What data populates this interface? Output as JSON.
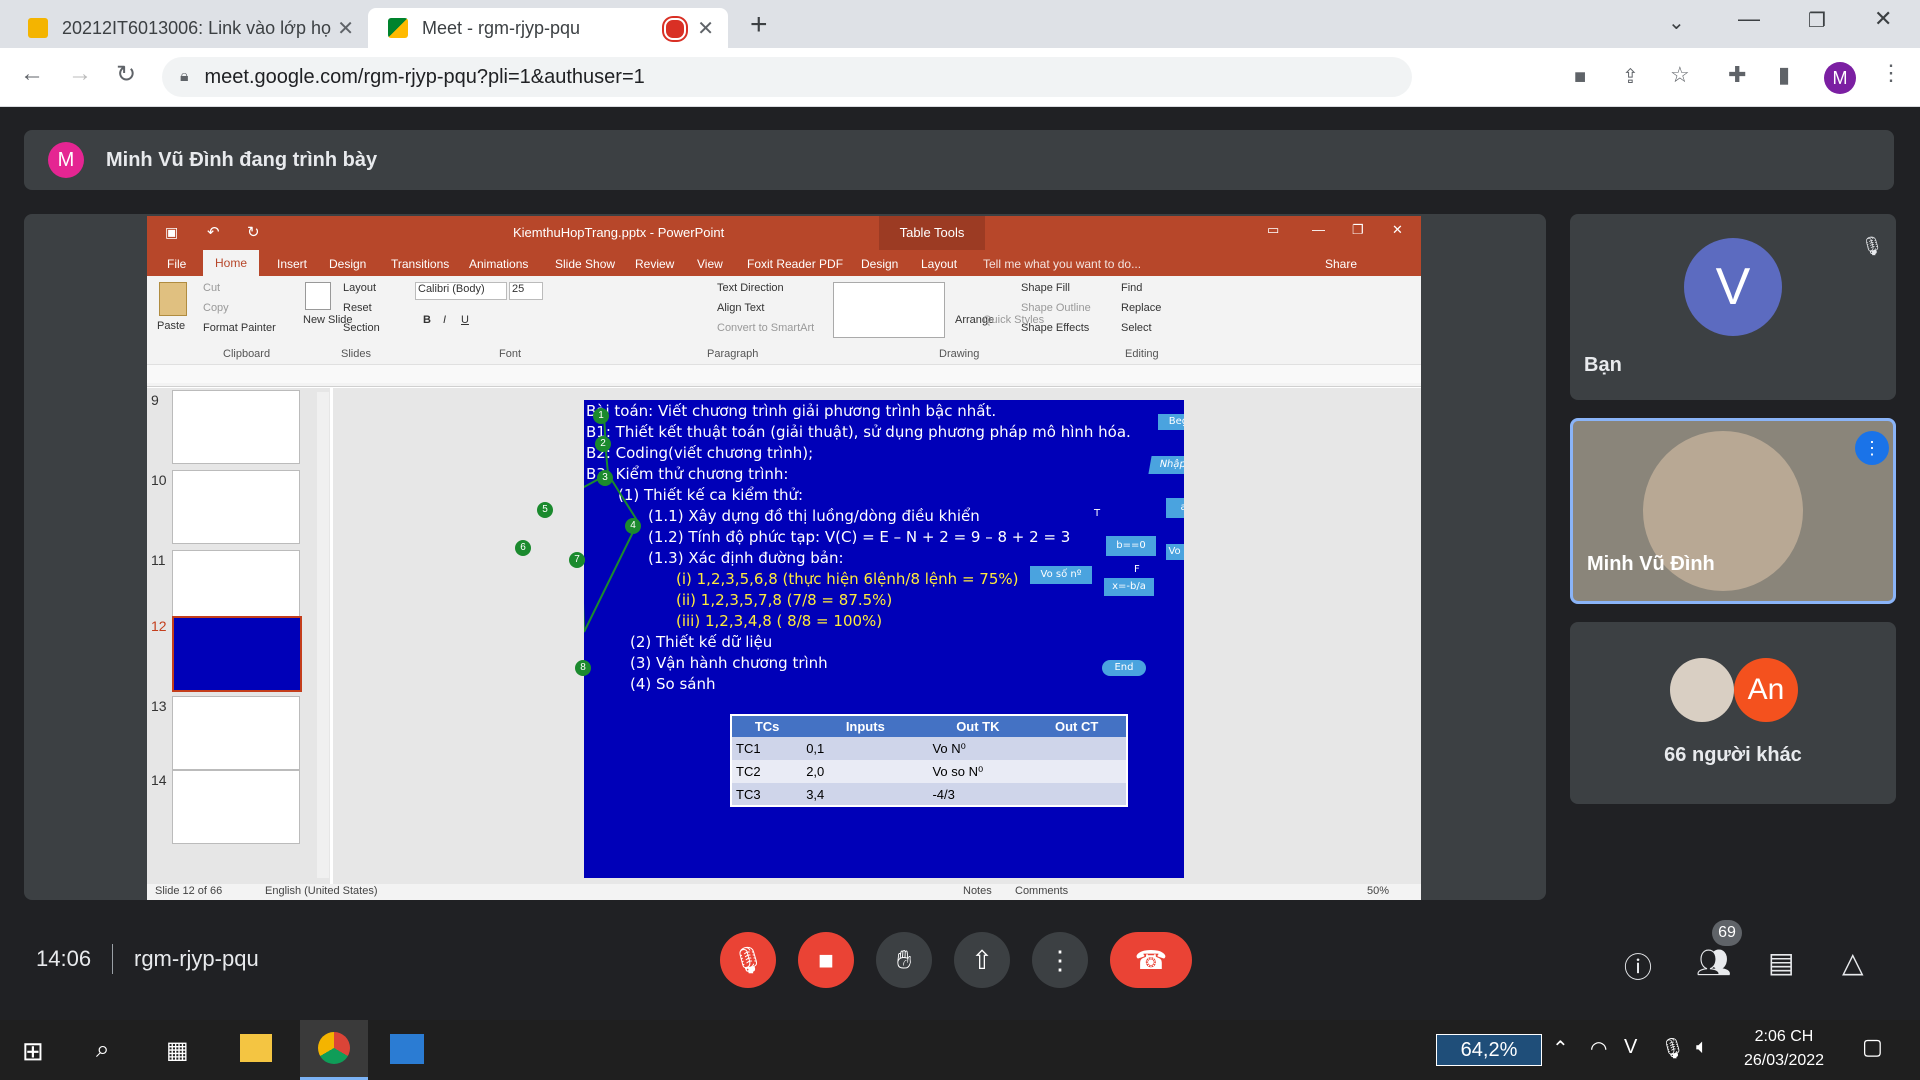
{
  "browser": {
    "tabs": [
      {
        "title": "20212IT6013006: Link vào lớp họ"
      },
      {
        "title": "Meet - rgm-rjyp-pqu"
      }
    ],
    "url": "meet.google.com/rgm-rjyp-pqu?pli=1&authuser=1",
    "profile_initial": "M"
  },
  "meet": {
    "presenter_initial": "M",
    "presenter_banner": "Minh Vũ Đình đang trình bày",
    "time": "14:06",
    "meeting_code": "rgm-rjyp-pqu",
    "participant_count": "69",
    "tiles": [
      {
        "initial": "V",
        "name": "Bạn"
      },
      {
        "name": "Minh Vũ Đình"
      },
      {
        "initial": "An",
        "name": "66 người khác"
      }
    ]
  },
  "ppt": {
    "window_title": "KiemthuHopTrang.pptx - PowerPoint",
    "contextual": "Table Tools",
    "menu": [
      "File",
      "Home",
      "Insert",
      "Design",
      "Transitions",
      "Animations",
      "Slide Show",
      "Review",
      "View",
      "Foxit Reader PDF",
      "Design",
      "Layout"
    ],
    "tell_me": "Tell me what you want to do...",
    "share": "Share",
    "ribbon": {
      "paste": "Paste",
      "cut": "Cut",
      "copy": "Copy",
      "format_painter": "Format Painter",
      "clipboard": "Clipboard",
      "new_slide": "New Slide",
      "layout": "Layout",
      "reset": "Reset",
      "section": "Section",
      "slides": "Slides",
      "font_name": "Calibri (Body)",
      "font_size": "25",
      "font": "Font",
      "text_direction": "Text Direction",
      "align_text": "Align Text",
      "convert_smartart": "Convert to SmartArt",
      "paragraph": "Paragraph",
      "arrange": "Arrange",
      "quick_styles": "Quick Styles",
      "shape_fill": "Shape Fill",
      "shape_outline": "Shape Outline",
      "shape_effects": "Shape Effects",
      "drawing": "Drawing",
      "find": "Find",
      "replace": "Replace",
      "select": "Select",
      "editing": "Editing"
    },
    "thumb_numbers": [
      "9",
      "10",
      "11",
      "12",
      "13",
      "14"
    ],
    "status": {
      "slide": "Slide 12 of 66",
      "lang": "English (United States)",
      "notes": "Notes",
      "comments": "Comments",
      "zoom": "50%"
    },
    "slide": {
      "lines": [
        "Bài toán: Viết chương trình giải phương trình bậc nhất.",
        "B1: Thiết kết thuật toán (giải thuật), sử dụng phương pháp mô hình hóa.",
        "B2: Coding(viết chương trình);",
        "B3: Kiểm thử chương trình:",
        "(1) Thiết kế ca kiểm thử:",
        "(1.1) Xây dựng đồ thị luồng/dòng điều khiển",
        "(1.2) Tính độ phức tạp:    V(C) = E – N + 2 = 9 – 8 + 2 = 3",
        "(1.3) Xác định đường bản:",
        "(i) 1,2,3,5,6,8 (thực hiện 6lệnh/8 lệnh = 75%)",
        "(ii) 1,2,3,5,7,8 (7/8 = 87.5%)",
        "(iii) 1,2,3,4,8 ( 8/8 = 100%)",
        "(2) Thiết kế dữ liệu",
        "(3) Vận hành chương trình",
        "(4) So sánh"
      ],
      "graph_nodes": [
        "1",
        "2",
        "3",
        "4",
        "5",
        "6",
        "7",
        "8"
      ],
      "flow": {
        "begin": "Begin",
        "input": "Nhập a,b",
        "cond1": "a!=0",
        "cond2": "b==0",
        "vo_so": "Vo số nº",
        "vo_nghiem": "Vo nghiem",
        "assign": "x=-b/a",
        "end": "End",
        "t": "T",
        "f": "F"
      },
      "table": {
        "headers": [
          "TCs",
          "Inputs",
          "Out TK",
          "Out CT"
        ],
        "rows": [
          [
            "TC1",
            "0,1",
            "Vo N⁰",
            ""
          ],
          [
            "TC2",
            "2,0",
            "Vo so N⁰",
            ""
          ],
          [
            "TC3",
            "3,4",
            "-4/3",
            ""
          ]
        ]
      }
    }
  },
  "taskbar": {
    "battery": "64,2%",
    "time": "2:06 CH",
    "date": "26/03/2022"
  },
  "colors": {
    "meet_bg": "#202124",
    "ppt_accent": "#b7472a",
    "slide_bg": "#0000b8",
    "end_call": "#ea4335"
  }
}
